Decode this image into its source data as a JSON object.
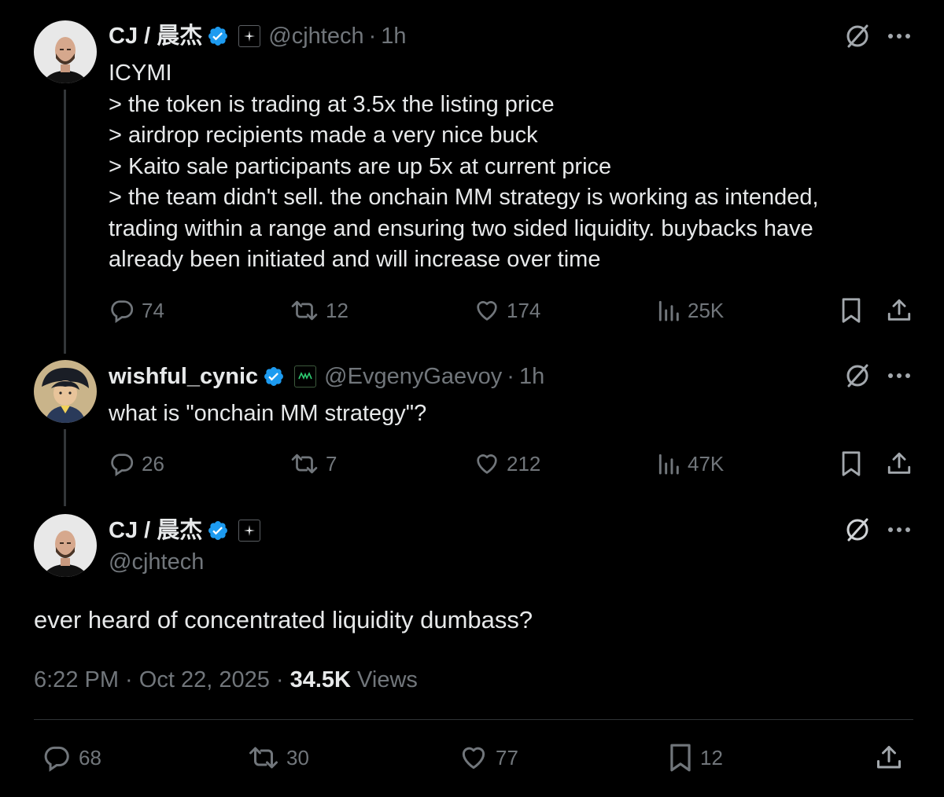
{
  "tweets": [
    {
      "name": "CJ / 晨杰",
      "handle": "@cjhtech",
      "separator": "·",
      "time": "1h",
      "lines": [
        "ICYMI",
        "> the token is trading at 3.5x the listing price",
        "> airdrop recipients made a very nice buck",
        "> Kaito sale participants are up 5x at current price",
        "> the team didn't sell. the onchain MM strategy is working as intended,",
        "trading within a range and ensuring two sided liquidity. buybacks have",
        "already been initiated and will increase over time"
      ],
      "replies": "74",
      "reposts": "12",
      "likes": "174",
      "views": "25K"
    },
    {
      "name": "wishful_cynic",
      "handle": "@EvgenyGaevoy",
      "separator": "·",
      "time": "1h",
      "lines": [
        "what is \"onchain MM strategy\"?"
      ],
      "replies": "26",
      "reposts": "7",
      "likes": "212",
      "views": "47K"
    }
  ],
  "main_tweet": {
    "name": "CJ / 晨杰",
    "handle": "@cjhtech",
    "text": "ever heard of concentrated liquidity dumbass?",
    "timestamp": "6:22 PM · Oct 22, 2025 · ",
    "views_count": "34.5K",
    "views_label": " Views",
    "replies": "68",
    "reposts": "30",
    "likes": "77",
    "bookmarks": "12"
  },
  "icons": {
    "verified": "verified-badge-icon",
    "affiliate": "affiliate-badge-icon",
    "grok": "grok-icon",
    "more": "more-icon",
    "reply": "reply-icon",
    "repost": "repost-icon",
    "like": "like-icon",
    "views": "views-icon",
    "bookmark": "bookmark-icon",
    "share": "share-icon"
  },
  "colors": {
    "background": "#000000",
    "text": "#e7e9ea",
    "secondary": "#71767b",
    "verified": "#1d9bf0",
    "divider": "#2f3336"
  }
}
